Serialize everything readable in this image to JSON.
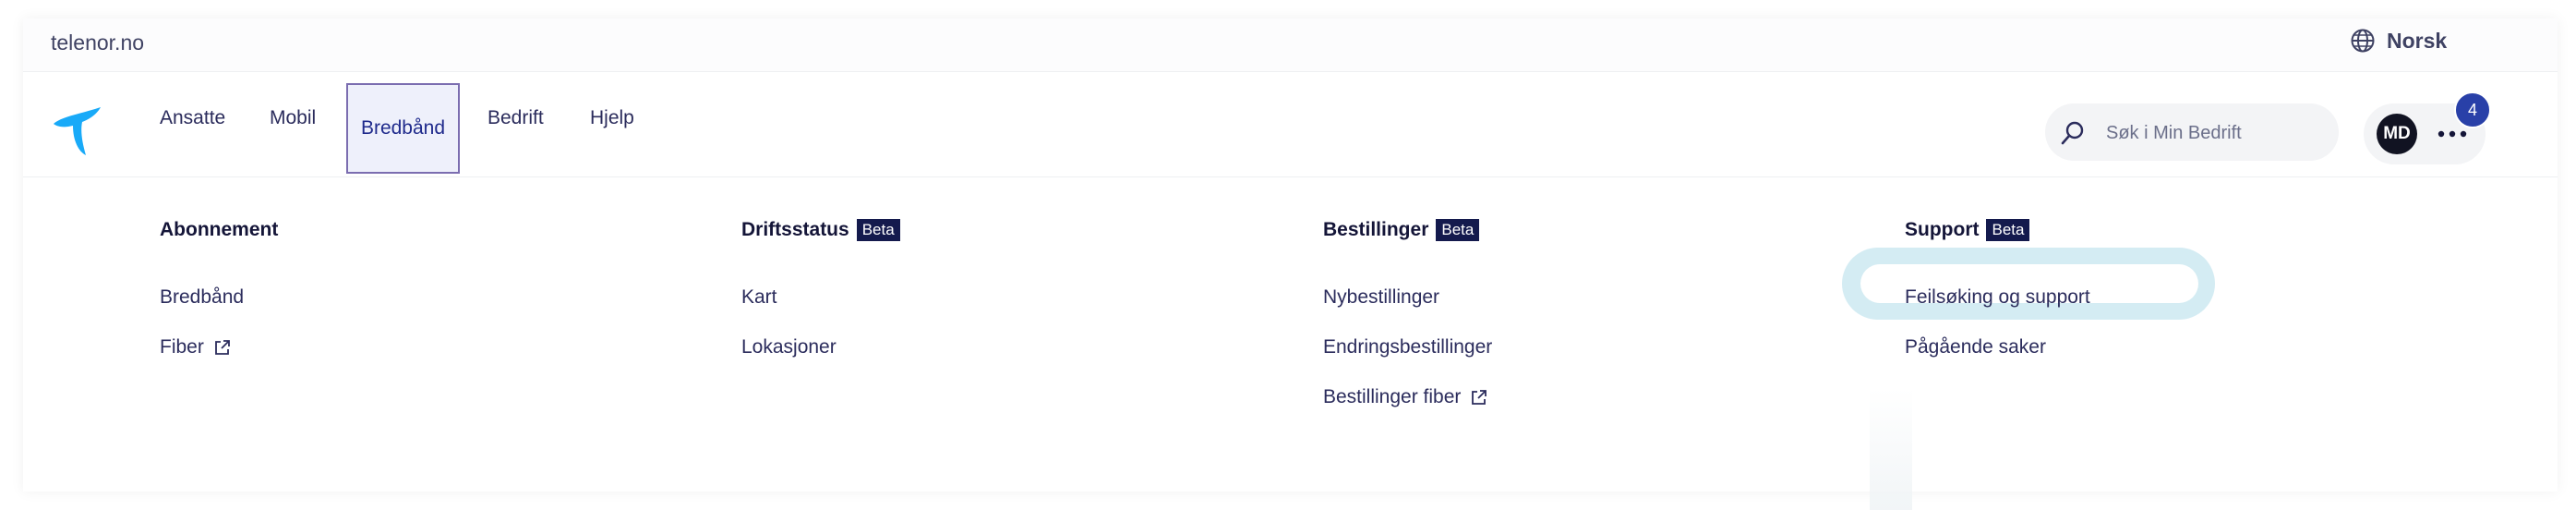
{
  "topbar": {
    "site_link": "telenor.no",
    "language": "Norsk",
    "language_icon": "globe-icon"
  },
  "nav": {
    "logo_icon": "telenor-logo-icon",
    "items": [
      {
        "label": "Ansatte"
      },
      {
        "label": "Mobil"
      },
      {
        "label": "Bredbånd",
        "active": true
      },
      {
        "label": "Bedrift"
      },
      {
        "label": "Hjelp"
      }
    ],
    "search_placeholder": "Søk i Min Bedrift",
    "user_initials": "MD",
    "notification_count": "4",
    "more_icon": "more-dots-icon"
  },
  "mega_menu": {
    "columns": [
      {
        "heading": "Abonnement",
        "beta": "",
        "links": [
          {
            "label": "Bredbånd",
            "external": false
          },
          {
            "label": "Fiber",
            "external": true
          }
        ]
      },
      {
        "heading": "Driftsstatus",
        "beta": "Beta",
        "links": [
          {
            "label": "Kart",
            "external": false
          },
          {
            "label": "Lokasjoner",
            "external": false
          }
        ]
      },
      {
        "heading": "Bestillinger",
        "beta": "Beta",
        "links": [
          {
            "label": "Nybestillinger",
            "external": false
          },
          {
            "label": "Endringsbestillinger",
            "external": false
          },
          {
            "label": "Bestillinger fiber",
            "external": true
          }
        ]
      },
      {
        "heading": "Support",
        "beta": "Beta",
        "links": [
          {
            "label": "Feilsøking og support",
            "external": false,
            "focused": true
          },
          {
            "label": "Pågående saker",
            "external": false
          }
        ]
      }
    ]
  },
  "colors": {
    "brand_blue": "#19aaf8",
    "active_border": "#7b6db0",
    "focus_ring": "#d4ecf3",
    "badge": "#2940a8",
    "beta_bg": "#141a4d"
  }
}
